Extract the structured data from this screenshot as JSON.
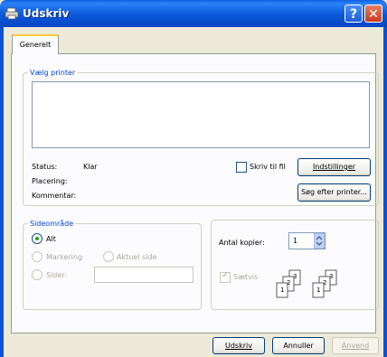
{
  "window": {
    "title": "Udskriv"
  },
  "tabs": [
    {
      "label": "Generelt"
    }
  ],
  "printer_group": {
    "legend": "Vælg printer",
    "status_label": "Status:",
    "status_value": "Klar",
    "location_label": "Placering:",
    "comment_label": "Kommentar:",
    "print_to_file": "Skriv til fil",
    "print_to_file_checked": false,
    "settings_button": "Indstillinger",
    "find_printer_button": "Søg efter printer..."
  },
  "page_range": {
    "legend": "Sideområde",
    "all": "Alt",
    "selection": "Markering",
    "current_page": "Aktuel side",
    "pages": "Sider:",
    "pages_value": "",
    "selected": "all"
  },
  "copies": {
    "label": "Antal kopier:",
    "value": "1",
    "collate": "Sætvis",
    "collate_checked": true
  },
  "footer": {
    "print_button": "Udskriv",
    "cancel_button": "Annuller",
    "apply_button": "Anvend"
  }
}
